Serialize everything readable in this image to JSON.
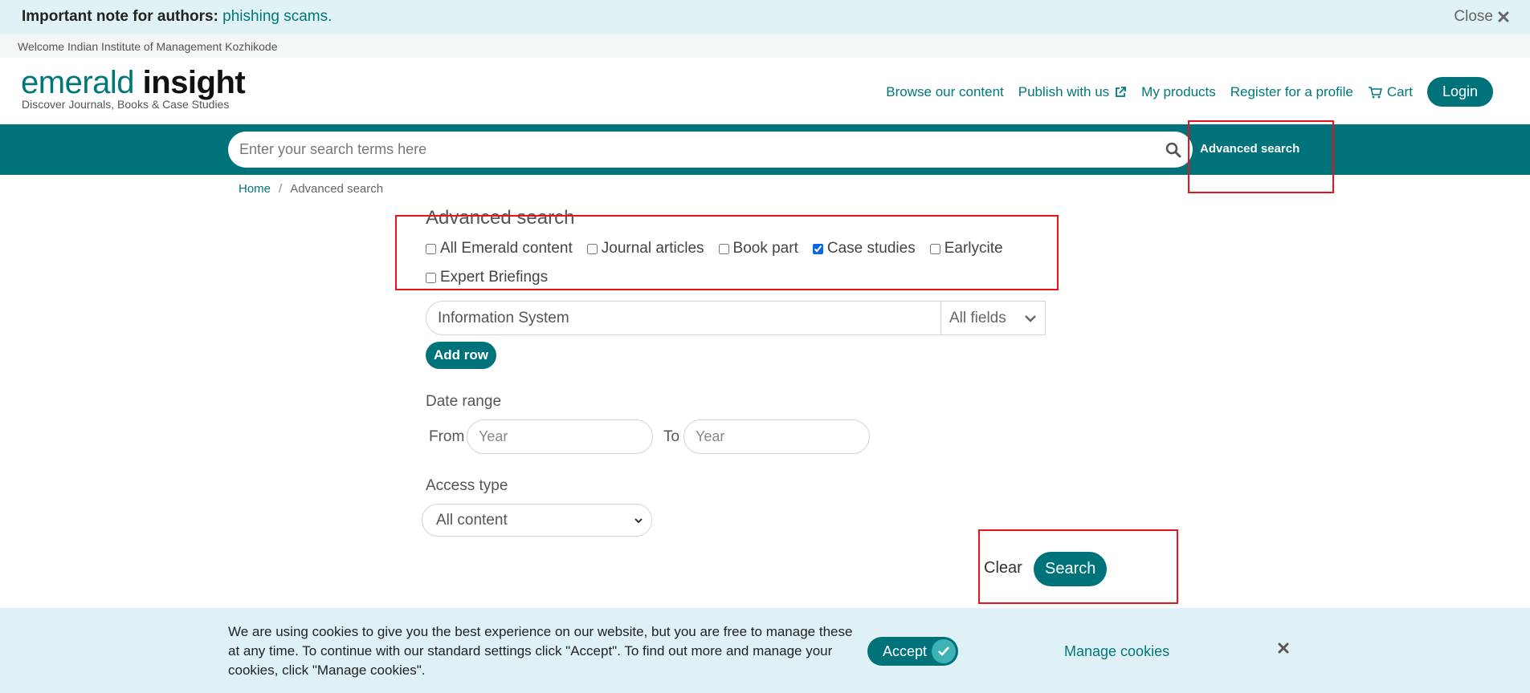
{
  "notice": {
    "prefix": "Important note for authors:",
    "link": "phishing scams.",
    "close_label": "Close"
  },
  "welcome": "Welcome Indian Institute of Management Kozhikode",
  "logo": {
    "word1": "emerald",
    "word2": "insight",
    "tagline": "Discover Journals, Books & Case Studies"
  },
  "nav": {
    "browse": "Browse our content",
    "publish": "Publish with us",
    "products": "My products",
    "register": "Register for a profile",
    "cart": "Cart",
    "login": "Login"
  },
  "search": {
    "placeholder": "Enter your search terms here",
    "advanced_label": "Advanced search"
  },
  "breadcrumb": {
    "home": "Home",
    "separator": "/",
    "current": "Advanced search"
  },
  "advanced": {
    "title": "Advanced search",
    "content_types": [
      {
        "label": "All Emerald content",
        "checked": false
      },
      {
        "label": "Journal articles",
        "checked": false
      },
      {
        "label": "Book part",
        "checked": false
      },
      {
        "label": "Case studies",
        "checked": true
      },
      {
        "label": "Earlycite",
        "checked": false
      },
      {
        "label": "Expert Briefings",
        "checked": false
      }
    ],
    "query_value": "Information System",
    "field_select": "All fields",
    "add_row_label": "Add row",
    "date_range_label": "Date range",
    "from_label": "From",
    "to_label": "To",
    "year_placeholder": "Year",
    "access_type_label": "Access type",
    "access_type_value": "All content",
    "clear_label": "Clear",
    "search_label": "Search"
  },
  "cookie": {
    "message": "We are using cookies to give you the best experience on our website, but you are free to manage these at any time. To continue with our standard settings click \"Accept\". To find out more and manage your cookies, click \"Manage cookies\".",
    "accept_label": "Accept",
    "manage_label": "Manage cookies"
  },
  "colors": {
    "brand_teal": "#00737a",
    "link_teal": "#00787a",
    "highlight_red": "#e8141c"
  }
}
